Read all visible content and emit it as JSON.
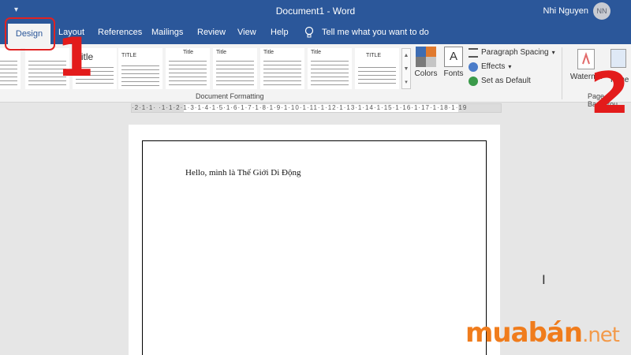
{
  "window": {
    "title": "Document1 - Word",
    "qat_glyph": "▾",
    "user_name": "Nhi Nguyen",
    "avatar_initials": "NN"
  },
  "tabs": {
    "active": "Design",
    "items": [
      "Layout",
      "References",
      "Mailings",
      "Review",
      "View",
      "Help"
    ],
    "tell_me": "Tell me what you want to do"
  },
  "ribbon": {
    "styles": [
      {
        "title": ""
      },
      {
        "title": "Title"
      },
      {
        "title": "TITLE"
      },
      {
        "title": "Title"
      },
      {
        "title": "Title"
      },
      {
        "title": "Title"
      },
      {
        "title": "Title"
      },
      {
        "title": "TITLE"
      }
    ],
    "colors_label": "Colors",
    "fonts_label": "Fonts",
    "fonts_glyph": "A",
    "paragraph_spacing": "Paragraph Spacing",
    "effects": "Effects",
    "set_as_default": "Set as Default",
    "document_formatting_label": "Document Formatting",
    "watermark_label": "Waterma",
    "page_color_label": "Page Colo",
    "page_background_label": "Page Backgrou",
    "colors_swatch": [
      "#3e6db3",
      "#e07a2f",
      "#7a7a7a",
      "#c5c5c5"
    ]
  },
  "ruler": {
    "ticks": "·2·1·1· ·1·1·2·1·3·1·4·1·5·1·6·1·7·1·8·1·9·1·10·1·11·1·12·1·13·1·14·1·15·1·16·1·17·1·18·1·19"
  },
  "document": {
    "body_text": "Hello, mình là Thế Giới Di Động",
    "cursor_glyph": "I"
  },
  "annotations": {
    "step1": "1",
    "step2": "2"
  },
  "watermark": {
    "brand": "muabán",
    "suffix": ".net"
  },
  "colors": {
    "title_bar": "#2b579a",
    "annotation_red": "#e31b1b",
    "brand_orange": "#f07c1c"
  }
}
